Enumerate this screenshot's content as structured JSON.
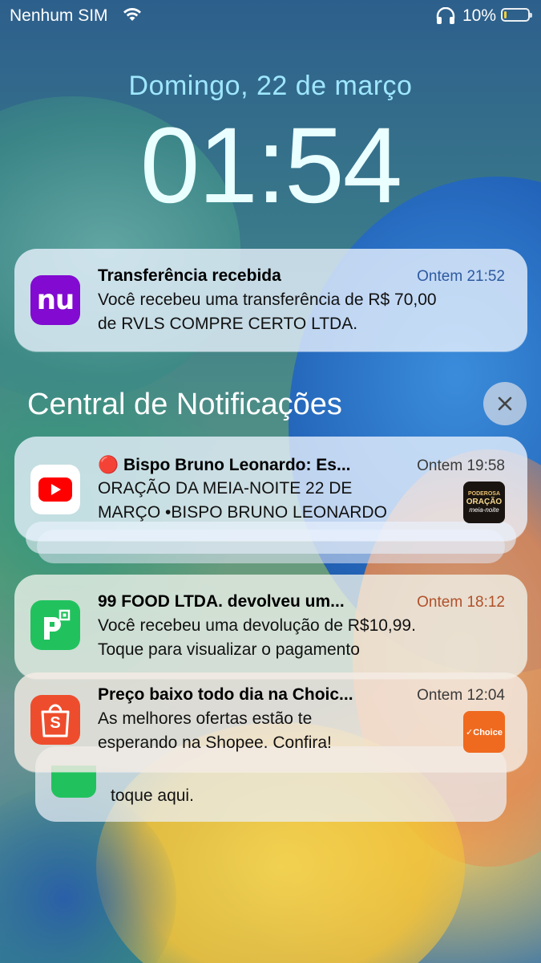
{
  "status_bar": {
    "carrier": "Nenhum SIM",
    "battery_pct": "10%",
    "battery_level": 0.1
  },
  "lock": {
    "date": "Domingo, 22 de março",
    "time": "01:54"
  },
  "notification_center": {
    "title": "Central de Notificações",
    "close_icon": "close-icon"
  },
  "notifications": [
    {
      "app": "nubank",
      "icon_text": "nu",
      "icon_color": "#820ad1",
      "title": "Transferência recebida",
      "time": "Ontem 21:52",
      "body_line1": "Você recebeu uma transferência de R$ 70,00",
      "body_line2": "de RVLS COMPRE CERTO LTDA."
    },
    {
      "app": "youtube",
      "icon_color": "#ff0000",
      "title": "🔴 Bispo Bruno Leonardo: Es...",
      "time": "Ontem 19:58",
      "body_line1": "ORAÇÃO DA MEIA-NOITE 22 DE",
      "body_line2": "MARÇO •BISPO BRUNO LEONARDO",
      "thumb_text1": "PODEROSA",
      "thumb_text2": "ORAÇÃO",
      "thumb_text3": "meia-noite"
    },
    {
      "app": "picpay",
      "icon_text": "P",
      "icon_color": "#21c25e",
      "title": "99 FOOD LTDA. devolveu um...",
      "time": "Ontem 18:12",
      "body_line1": "Você recebeu uma devolução de R$10,99.",
      "body_line2": "Toque para visualizar o pagamento"
    },
    {
      "app": "shopee",
      "icon_text": "S",
      "icon_color": "#ee4d2d",
      "title": "Preço baixo todo dia na Choic...",
      "time": "Ontem 12:04",
      "body_line1": "As melhores ofertas estão te",
      "body_line2": "esperando na Shopee. Confira!",
      "thumb_text": "✓Choice",
      "thumb_color": "#ef6a1f"
    }
  ],
  "stacked_behind": {
    "body_line": "toque aqui."
  }
}
